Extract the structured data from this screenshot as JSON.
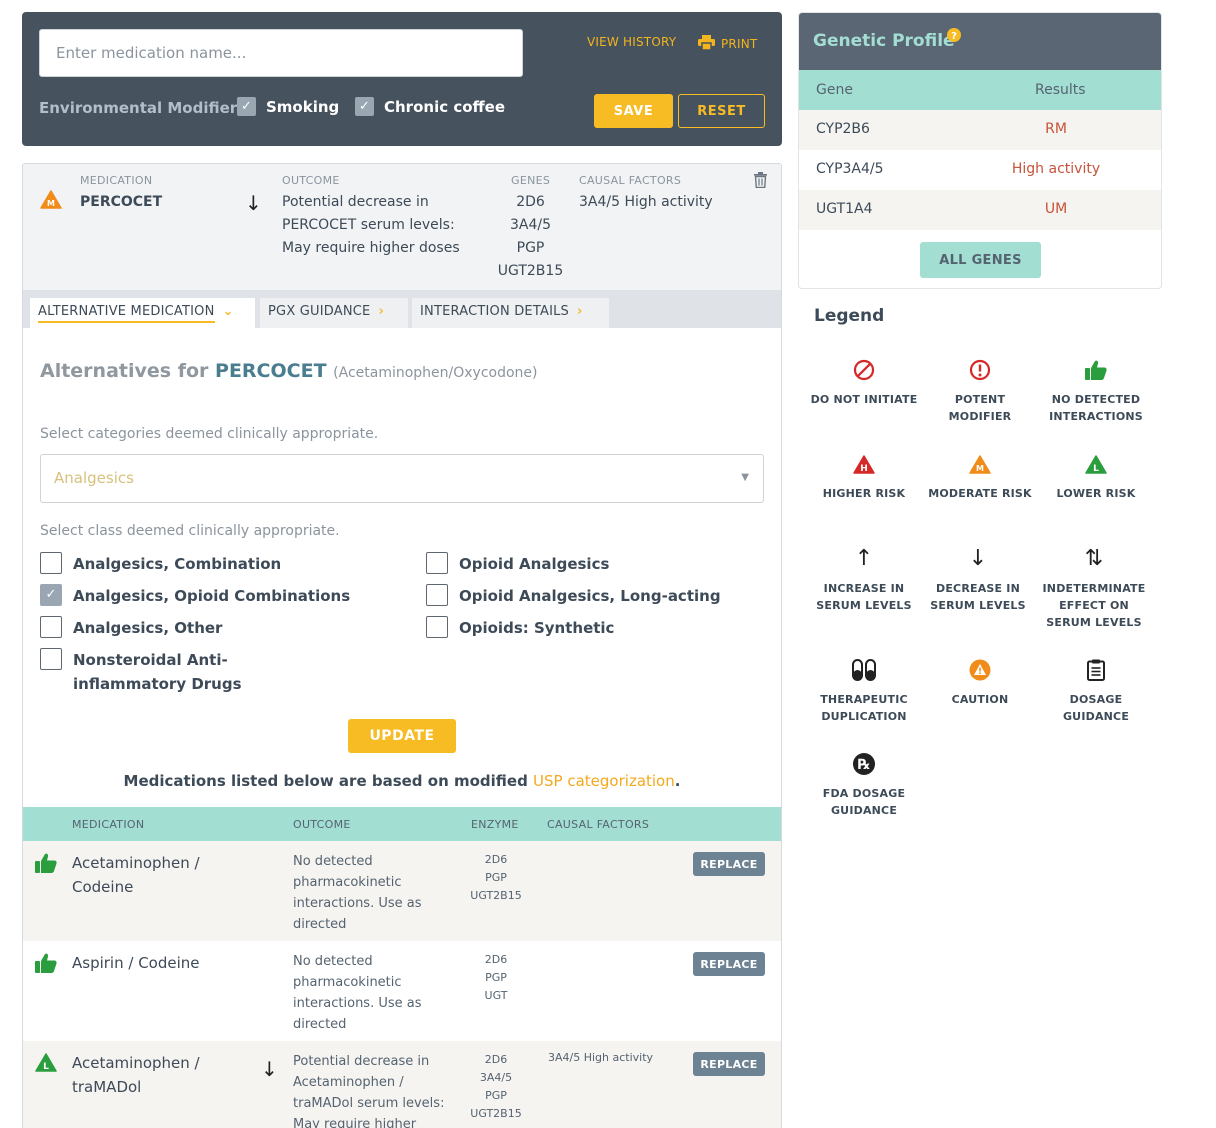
{
  "topbar": {
    "search_placeholder": "Enter medication name...",
    "view_history": "VIEW HISTORY",
    "print": "PRINT",
    "env_label": "Environmental Modifiers",
    "modifiers": [
      {
        "label": "Smoking",
        "checked": true
      },
      {
        "label": "Chronic coffee",
        "checked": true
      }
    ],
    "save": "SAVE",
    "reset": "RESET"
  },
  "summary": {
    "labels": {
      "medication": "MEDICATION",
      "outcome": "OUTCOME",
      "genes": "GENES",
      "causal": "CAUSAL FACTORS"
    },
    "medication": "PERCOCET",
    "risk": "M",
    "outcome": "Potential decrease in PERCOCET serum levels: May require higher doses",
    "genes": [
      "2D6",
      "3A4/5",
      "PGP",
      "UGT2B15"
    ],
    "causal": "3A4/5 High activity"
  },
  "tabs": [
    {
      "label": "ALTERNATIVE MEDICATION"
    },
    {
      "label": "PGX GUIDANCE"
    },
    {
      "label": "INTERACTION DETAILS"
    }
  ],
  "alternatives": {
    "title_prefix": "Alternatives for",
    "drug": "PERCOCET",
    "generic": "(Acetaminophen/Oxycodone)",
    "category_label": "Select categories deemed clinically appropriate.",
    "category_value": "Analgesics",
    "class_label": "Select class deemed clinically appropriate.",
    "classes": [
      {
        "label": "Analgesics, Combination",
        "checked": false
      },
      {
        "label": "Analgesics, Opioid Combinations",
        "checked": true
      },
      {
        "label": "Analgesics, Other",
        "checked": false
      },
      {
        "label": "Nonsteroidal Anti-inflammatory Drugs",
        "checked": false
      },
      {
        "label": "Opioid Analgesics",
        "checked": false
      },
      {
        "label": "Opioid Analgesics, Long-acting",
        "checked": false
      },
      {
        "label": "Opioids: Synthetic",
        "checked": false
      }
    ],
    "update": "UPDATE",
    "note_prefix": "Medications listed below are based on modified",
    "note_link": "USP categorization",
    "note_suffix": "."
  },
  "alt_table": {
    "headers": {
      "medication": "MEDICATION",
      "outcome": "OUTCOME",
      "enzyme": "ENZYME",
      "causal": "CAUSAL FACTORS"
    },
    "replace_label": "REPLACE",
    "rows": [
      {
        "icon": "thumbs-up-icon",
        "medication": "Acetaminophen / Codeine",
        "arrow": "",
        "outcome": "No detected pharmacokinetic interactions. Use as directed",
        "enzymes": [
          "2D6",
          "PGP",
          "UGT2B15"
        ],
        "causal": "",
        "bg": "#f5f4f1"
      },
      {
        "icon": "thumbs-up-icon",
        "medication": "Aspirin / Codeine",
        "arrow": "",
        "outcome": "No detected pharmacokinetic interactions. Use as directed",
        "enzymes": [
          "2D6",
          "PGP",
          "UGT"
        ],
        "causal": "",
        "bg": "#ffffff"
      },
      {
        "icon": "lower-risk-icon",
        "medication": "Acetaminophen / traMADol",
        "arrow": "↓",
        "outcome": "Potential decrease in Acetaminophen / traMADol serum levels: May require higher",
        "enzymes": [
          "2D6",
          "3A4/5",
          "PGP",
          "UGT2B15"
        ],
        "causal": "3A4/5 High activity",
        "bg": "#f5f4f1"
      }
    ]
  },
  "genetic": {
    "title": "Genetic Profile",
    "headers": {
      "gene": "Gene",
      "results": "Results"
    },
    "rows": [
      {
        "gene": "CYP2B6",
        "result": "RM"
      },
      {
        "gene": "CYP3A4/5",
        "result": "High activity"
      },
      {
        "gene": "UGT1A4",
        "result": "UM"
      }
    ],
    "all_genes": "ALL GENES"
  },
  "legend": {
    "title": "Legend",
    "items": [
      {
        "icon": "do-not-initiate-icon",
        "label": "DO NOT INITIATE"
      },
      {
        "icon": "potent-modifier-icon",
        "label": "POTENT MODIFIER"
      },
      {
        "icon": "no-interactions-icon",
        "label": "NO DETECTED INTERACTIONS"
      },
      {
        "icon": "higher-risk-icon",
        "label": "HIGHER RISK"
      },
      {
        "icon": "moderate-risk-icon",
        "label": "MODERATE RISK"
      },
      {
        "icon": "lower-risk-icon",
        "label": "LOWER RISK"
      },
      {
        "icon": "increase-arrow-icon",
        "label": "INCREASE IN SERUM LEVELS"
      },
      {
        "icon": "decrease-arrow-icon",
        "label": "DECREASE IN SERUM LEVELS"
      },
      {
        "icon": "indeterminate-arrows-icon",
        "label": "INDETERMINATE EFFECT ON SERUM LEVELS"
      },
      {
        "icon": "pills-icon",
        "label": "THERAPEUTIC DUPLICATION"
      },
      {
        "icon": "caution-icon",
        "label": "CAUTION"
      },
      {
        "icon": "clipboard-icon",
        "label": "DOSAGE GUIDANCE"
      },
      {
        "icon": "rx-icon",
        "label": "FDA DOSAGE GUIDANCE"
      }
    ]
  },
  "colors": {
    "dark_panel": "#46525e",
    "accent": "#f7bc24",
    "teal": "#a3ded3",
    "teal_text": "#4a7d90",
    "result_red": "#c6533a",
    "green": "#2a9d3d",
    "red": "#d62828",
    "orange": "#f08c1a"
  }
}
